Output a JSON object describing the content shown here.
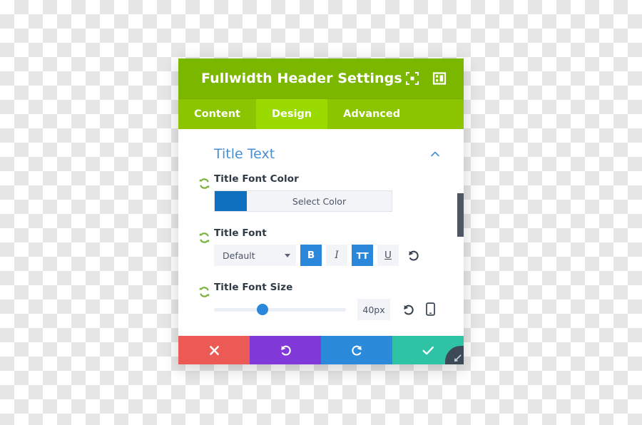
{
  "panel": {
    "title": "Fullwidth Header Settings",
    "titlebar_icons": [
      {
        "name": "expand-fullscreen-icon",
        "label": "Expand"
      },
      {
        "name": "layout-panel-icon",
        "label": "Change layout"
      }
    ],
    "tabs": [
      {
        "label": "Content",
        "active": false
      },
      {
        "label": "Design",
        "active": true
      },
      {
        "label": "Advanced",
        "active": false
      }
    ],
    "section": {
      "title": "Title Text",
      "collapse_icon": "chevron-up-icon",
      "expanded": true
    },
    "fields": {
      "font_color": {
        "label": "Title Font Color",
        "swatch_color": "#1070c0",
        "button_label": "Select Color",
        "reset_icon": "reset-circular-arrows-icon"
      },
      "font": {
        "label": "Title Font",
        "select_value": "Default",
        "reset_icon": "reset-circular-arrows-icon",
        "undo_icon": "undo-arrow-icon",
        "buttons": [
          {
            "name": "bold-button",
            "label": "B",
            "active": true
          },
          {
            "name": "italic-button",
            "label": "I",
            "active": false
          },
          {
            "name": "uppercase-button",
            "label": "TT",
            "active": true
          },
          {
            "name": "underline-button",
            "label": "U",
            "active": false
          }
        ]
      },
      "font_size": {
        "label": "Title Font Size",
        "value": "40px",
        "slider_percent": 37,
        "reset_icon": "reset-circular-arrows-icon",
        "undo_icon": "undo-arrow-icon",
        "responsive_icon": "mobile-device-icon"
      }
    },
    "scrollbar": {
      "thumb_top_percent": 31,
      "thumb_height_percent": 21
    },
    "footer_buttons": [
      {
        "name": "cancel-button",
        "icon": "close-x-icon",
        "color": "#eb5a55"
      },
      {
        "name": "undo-button",
        "icon": "undo-arrow-icon",
        "color": "#8139d9"
      },
      {
        "name": "redo-button",
        "icon": "redo-arrow-icon",
        "color": "#2b8ad9"
      },
      {
        "name": "save-button",
        "icon": "checkmark-icon",
        "color": "#2fc3a5"
      }
    ],
    "resize_grip_icon": "resize-handle-icon"
  },
  "colors": {
    "titlebar_green": "#7cb700",
    "tabbar_green": "#8bc400",
    "tab_active_green": "#9ada00",
    "section_blue": "#4a8fd1",
    "accent_blue": "#2b87da",
    "reset_green": "#7cb342"
  }
}
